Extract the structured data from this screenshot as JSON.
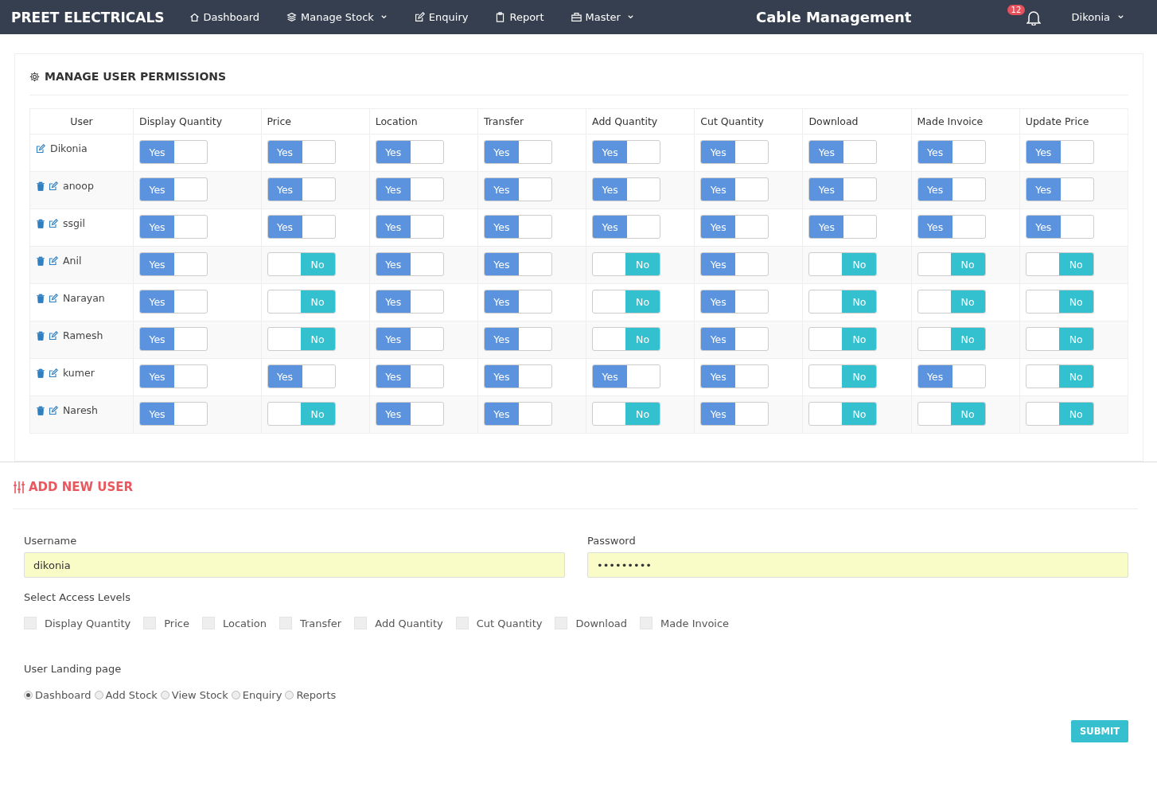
{
  "navbar": {
    "brand": "PREET ELECTRICALS",
    "items": [
      {
        "kind": "home",
        "label": "Dashboard",
        "dropdown": false
      },
      {
        "kind": "layers",
        "label": "Manage Stock",
        "dropdown": true
      },
      {
        "kind": "edit",
        "label": "Enquiry",
        "dropdown": false
      },
      {
        "kind": "clipboard",
        "label": "Report",
        "dropdown": false
      },
      {
        "kind": "briefcase",
        "label": "Master",
        "dropdown": true
      }
    ],
    "title": "Cable Management",
    "notification_count": "12",
    "user": "Dikonia"
  },
  "permissions": {
    "title": "MANAGE USER PERMISSIONS",
    "columns": [
      "User",
      "Display Quantity",
      "Price",
      "Location",
      "Transfer",
      "Add Quantity",
      "Cut Quantity",
      "Download",
      "Made Invoice",
      "Update Price"
    ],
    "rows": [
      {
        "user": "Dikonia",
        "deletable": false,
        "toggles": [
          {
            "on": true,
            "label": "Yes"
          },
          {
            "on": true,
            "label": "Yes"
          },
          {
            "on": true,
            "label": "Yes"
          },
          {
            "on": true,
            "label": "Yes"
          },
          {
            "on": true,
            "label": "Yes"
          },
          {
            "on": true,
            "label": "Yes"
          },
          {
            "on": true,
            "label": "Yes"
          },
          {
            "on": true,
            "label": "Yes"
          },
          {
            "on": true,
            "label": "Yes"
          }
        ]
      },
      {
        "user": "anoop",
        "deletable": true,
        "toggles": [
          {
            "on": true,
            "label": "Yes"
          },
          {
            "on": true,
            "label": "Yes"
          },
          {
            "on": true,
            "label": "Yes"
          },
          {
            "on": true,
            "label": "Yes"
          },
          {
            "on": true,
            "label": "Yes"
          },
          {
            "on": true,
            "label": "Yes"
          },
          {
            "on": true,
            "label": "Yes"
          },
          {
            "on": true,
            "label": "Yes"
          },
          {
            "on": true,
            "label": "Yes"
          }
        ]
      },
      {
        "user": "ssgil",
        "deletable": true,
        "toggles": [
          {
            "on": true,
            "label": "Yes"
          },
          {
            "on": true,
            "label": "Yes"
          },
          {
            "on": true,
            "label": "Yes"
          },
          {
            "on": true,
            "label": "Yes"
          },
          {
            "on": true,
            "label": "Yes"
          },
          {
            "on": true,
            "label": "Yes"
          },
          {
            "on": true,
            "label": "Yes"
          },
          {
            "on": true,
            "label": "Yes"
          },
          {
            "on": true,
            "label": "Yes"
          }
        ]
      },
      {
        "user": "Anil",
        "deletable": true,
        "toggles": [
          {
            "on": true,
            "label": "Yes"
          },
          {
            "on": false,
            "label": "No"
          },
          {
            "on": true,
            "label": "Yes"
          },
          {
            "on": true,
            "label": "Yes"
          },
          {
            "on": false,
            "label": "No"
          },
          {
            "on": true,
            "label": "Yes"
          },
          {
            "on": false,
            "label": "No"
          },
          {
            "on": false,
            "label": "No"
          },
          {
            "on": false,
            "label": "No"
          }
        ]
      },
      {
        "user": "Narayan",
        "deletable": true,
        "toggles": [
          {
            "on": true,
            "label": "Yes"
          },
          {
            "on": false,
            "label": "No"
          },
          {
            "on": true,
            "label": "Yes"
          },
          {
            "on": true,
            "label": "Yes"
          },
          {
            "on": false,
            "label": "No"
          },
          {
            "on": true,
            "label": "Yes"
          },
          {
            "on": false,
            "label": "No"
          },
          {
            "on": false,
            "label": "No"
          },
          {
            "on": false,
            "label": "No"
          }
        ]
      },
      {
        "user": "Ramesh",
        "deletable": true,
        "toggles": [
          {
            "on": true,
            "label": "Yes"
          },
          {
            "on": false,
            "label": "No"
          },
          {
            "on": true,
            "label": "Yes"
          },
          {
            "on": true,
            "label": "Yes"
          },
          {
            "on": false,
            "label": "No"
          },
          {
            "on": true,
            "label": "Yes"
          },
          {
            "on": false,
            "label": "No"
          },
          {
            "on": false,
            "label": "No"
          },
          {
            "on": false,
            "label": "No"
          }
        ]
      },
      {
        "user": "kumer",
        "deletable": true,
        "toggles": [
          {
            "on": true,
            "label": "Yes"
          },
          {
            "on": true,
            "label": "Yes"
          },
          {
            "on": true,
            "label": "Yes"
          },
          {
            "on": true,
            "label": "Yes"
          },
          {
            "on": true,
            "label": "Yes"
          },
          {
            "on": true,
            "label": "Yes"
          },
          {
            "on": false,
            "label": "No"
          },
          {
            "on": true,
            "label": "Yes"
          },
          {
            "on": false,
            "label": "No"
          }
        ]
      },
      {
        "user": "Naresh",
        "deletable": true,
        "toggles": [
          {
            "on": true,
            "label": "Yes"
          },
          {
            "on": false,
            "label": "No"
          },
          {
            "on": true,
            "label": "Yes"
          },
          {
            "on": true,
            "label": "Yes"
          },
          {
            "on": false,
            "label": "No"
          },
          {
            "on": true,
            "label": "Yes"
          },
          {
            "on": false,
            "label": "No"
          },
          {
            "on": false,
            "label": "No"
          },
          {
            "on": false,
            "label": "No"
          }
        ]
      }
    ]
  },
  "add_user": {
    "title": "ADD NEW USER",
    "username": {
      "label": "Username",
      "value": "dikonia"
    },
    "password": {
      "label": "Password",
      "value": "•••••••••"
    },
    "access_label": "Select Access Levels",
    "access_levels": [
      {
        "label": "Display Quantity",
        "checked": false
      },
      {
        "label": "Price",
        "checked": false
      },
      {
        "label": "Location",
        "checked": false
      },
      {
        "label": "Transfer",
        "checked": false
      },
      {
        "label": "Add Quantity",
        "checked": false
      },
      {
        "label": "Cut Quantity",
        "checked": false
      },
      {
        "label": "Download",
        "checked": false
      },
      {
        "label": "Made Invoice",
        "checked": false
      }
    ],
    "landing_label": "User Landing page",
    "landing_pages": [
      {
        "label": "Dashboard",
        "selected": true
      },
      {
        "label": "Add Stock",
        "selected": false
      },
      {
        "label": "View Stock",
        "selected": false
      },
      {
        "label": "Enquiry",
        "selected": false
      },
      {
        "label": "Reports",
        "selected": false
      }
    ],
    "submit": "SUBMIT"
  }
}
